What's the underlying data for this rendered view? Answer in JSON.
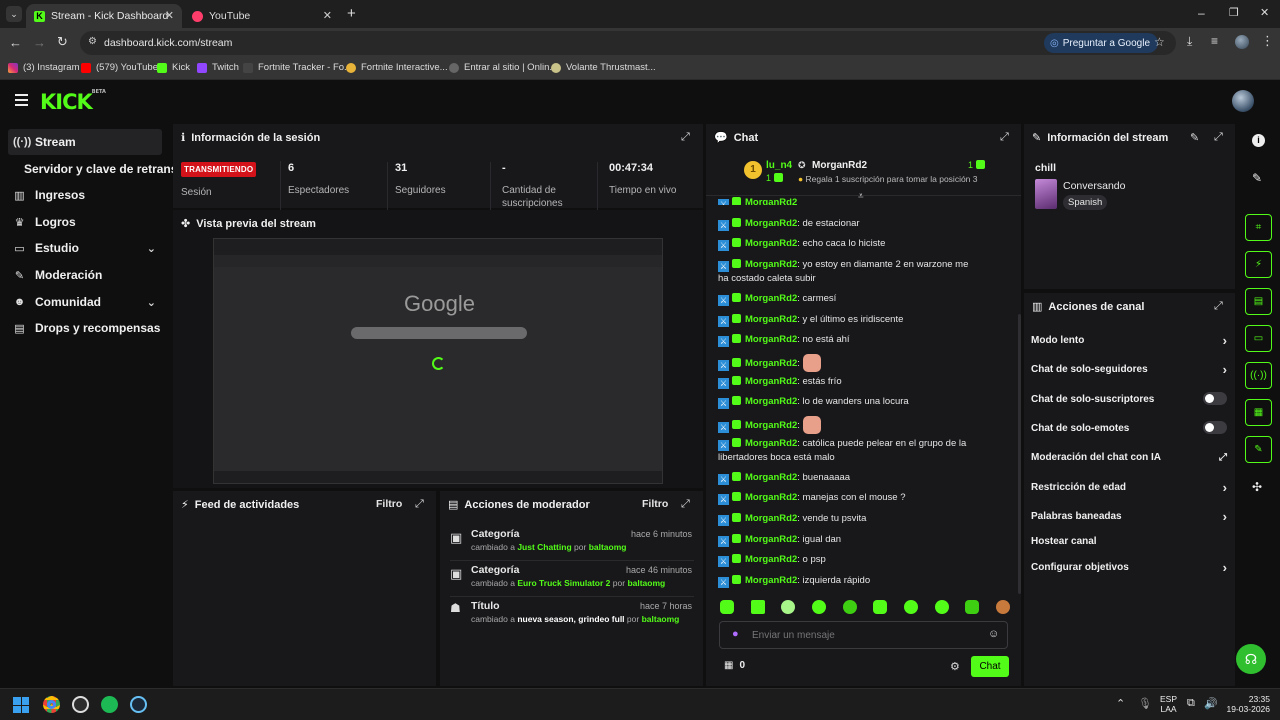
{
  "browser": {
    "tabs": [
      {
        "title": "Stream - Kick Dashboard",
        "active": true
      },
      {
        "title": "YouTube",
        "active": false
      }
    ],
    "new_tab": "+",
    "url": "dashboard.kick.com/stream",
    "ask_google": "Preguntar a Google",
    "bookmarks": [
      "(3) Instagram",
      "(579) YouTube",
      "Kick",
      "Twitch",
      "Fortnite Tracker - Fo...",
      "Fortnite Interactive...",
      "Entrar al sitio | Onlin...",
      "Volante Thrustmast..."
    ]
  },
  "header": {
    "logo": "KICK",
    "logo_tag": "BETA"
  },
  "sidebar": {
    "items": [
      {
        "label": "Stream",
        "icon": "broadcast-icon"
      },
      {
        "label": "Servidor y clave de retransm",
        "icon": ""
      },
      {
        "label": "Ingresos",
        "icon": "chart-icon"
      },
      {
        "label": "Logros",
        "icon": "trophy-icon"
      },
      {
        "label": "Estudio",
        "icon": "studio-icon"
      },
      {
        "label": "Moderación",
        "icon": "wrench-icon"
      },
      {
        "label": "Comunidad",
        "icon": "users-icon"
      },
      {
        "label": "Drops y recompensas",
        "icon": "gift-icon"
      }
    ]
  },
  "session": {
    "title": "Información de la sesión",
    "live_badge": "TRANSMITIENDO",
    "stats": [
      {
        "label": "Sesión",
        "value": ""
      },
      {
        "label": "Espectadores",
        "value": "6"
      },
      {
        "label": "Seguidores",
        "value": "31"
      },
      {
        "label": "Cantidad de suscripciones",
        "value": "-"
      },
      {
        "label": "Tiempo en vivo",
        "value": "00:47:34"
      }
    ]
  },
  "preview": {
    "title": "Vista previa del stream",
    "google_text": "Google"
  },
  "activity": {
    "title": "Feed de actividades",
    "filter": "Filtro"
  },
  "modactions": {
    "title": "Acciones de moderador",
    "filter": "Filtro",
    "items": [
      {
        "title": "Categoría",
        "time": "hace 6 minutos",
        "pre": "cambiado a",
        "value": "Just Chatting",
        "by": "por",
        "user": "baltaomg"
      },
      {
        "title": "Categoría",
        "time": "hace 46 minutos",
        "pre": "cambiado a",
        "value": "Euro Truck Simulator 2",
        "by": "por",
        "user": "baltaomg"
      },
      {
        "title": "Título",
        "time": "hace 7 horas",
        "pre": "cambiado a",
        "value": "nueva season, grindeo full",
        "by": "por",
        "user": "baltaomg"
      }
    ]
  },
  "chat": {
    "title": "Chat",
    "leaderboard": {
      "first_user": "lu_n4",
      "first_count": "1",
      "first_subs": "1",
      "second_user": "MorganRd2",
      "second_count": "1",
      "note": "Regala 1 suscripción para tomar la posición 3"
    },
    "messages": [
      {
        "user": "MorganRd2",
        "text": ": de estacionar"
      },
      {
        "user": "MorganRd2",
        "text": ": echo caca lo hiciste"
      },
      {
        "user": "MorganRd2",
        "text": ": yo estoy en diamante 2 en warzone me ha costado caleta subir"
      },
      {
        "user": "MorganRd2",
        "text": ": carmesí"
      },
      {
        "user": "MorganRd2",
        "text": ": y el último es iridiscente"
      },
      {
        "user": "MorganRd2",
        "text": ": no está ahí"
      },
      {
        "user": "MorganRd2",
        "text": ":",
        "emote": true
      },
      {
        "user": "MorganRd2",
        "text": ": estás frío"
      },
      {
        "user": "MorganRd2",
        "text": ": lo de wanders una locura"
      },
      {
        "user": "MorganRd2",
        "text": ":",
        "emote": true
      },
      {
        "user": "MorganRd2",
        "text": ": católica puede pelear en el grupo de la libertadores boca está malo"
      },
      {
        "user": "MorganRd2",
        "text": ": buenaaaaa"
      },
      {
        "user": "MorganRd2",
        "text": ": manejas con el mouse ?"
      },
      {
        "user": "MorganRd2",
        "text": ": vende tu psvita"
      },
      {
        "user": "MorganRd2",
        "text": ": igual dan"
      },
      {
        "user": "MorganRd2",
        "text": ": o psp"
      },
      {
        "user": "MorganRd2",
        "text": ": izquierda rápido"
      }
    ],
    "input_placeholder": "Enviar un mensaje",
    "points": "0",
    "send_label": "Chat"
  },
  "streaminfo": {
    "title": "Información del stream",
    "stream_title": "chill",
    "category": "Conversando",
    "language": "Spanish"
  },
  "channel_actions": {
    "title": "Acciones de canal",
    "items": [
      {
        "label": "Modo lento",
        "control": "chevron"
      },
      {
        "label": "Chat de solo-seguidores",
        "control": "chevron"
      },
      {
        "label": "Chat de solo-suscriptores",
        "control": "toggle"
      },
      {
        "label": "Chat de solo-emotes",
        "control": "toggle"
      },
      {
        "label": "Moderación del chat con IA",
        "control": "external"
      },
      {
        "label": "Restricción de edad",
        "control": "chevron"
      },
      {
        "label": "Palabras baneadas",
        "control": "chevron"
      },
      {
        "label": "Hostear canal",
        "control": "none"
      },
      {
        "label": "Configurar objetivos",
        "control": "chevron"
      }
    ]
  },
  "taskbar": {
    "lang": "ESP",
    "lang2": "LAA",
    "time": "23:35",
    "date": "19-03-2026"
  },
  "colors": {
    "accent": "#53fc18",
    "live": "#d31219",
    "panel": "#18181b",
    "background": "#0f0f10"
  }
}
